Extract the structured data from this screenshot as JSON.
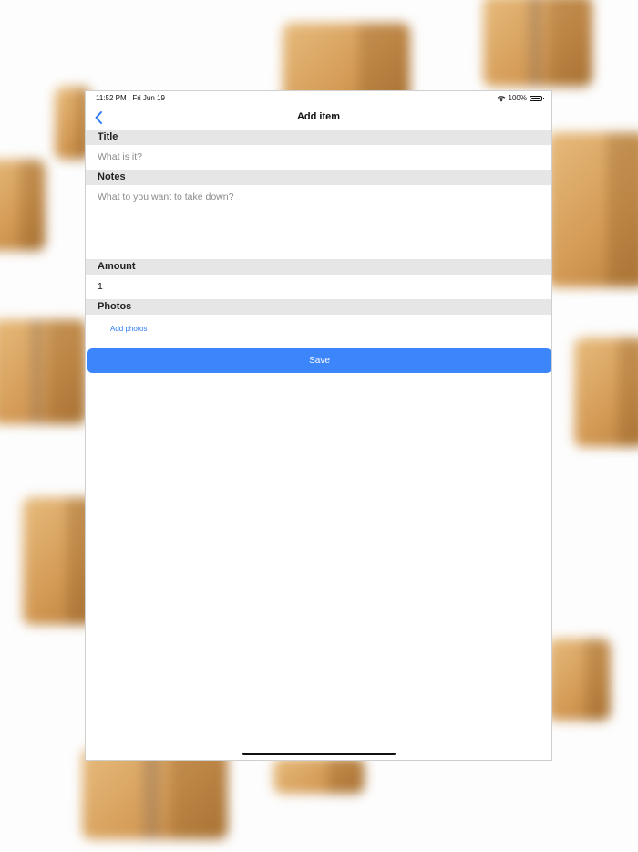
{
  "status_bar": {
    "time": "11:52 PM",
    "date": "Fri Jun 19",
    "battery": "100%",
    "wifi_icon": "wifi-icon",
    "battery_icon": "battery-icon"
  },
  "nav": {
    "title": "Add item",
    "back_icon": "chevron-left-icon"
  },
  "form": {
    "title": {
      "header": "Title",
      "placeholder": "What is it?"
    },
    "notes": {
      "header": "Notes",
      "placeholder": "What to you want to take down?"
    },
    "amount": {
      "header": "Amount",
      "value": "1"
    },
    "photos": {
      "header": "Photos",
      "add_label": "Add photos"
    },
    "save_label": "Save"
  },
  "colors": {
    "accent": "#3d85fb",
    "link": "#2f7bf5",
    "section_header_bg": "#e6e6e6",
    "box_brown": "#d39a55"
  }
}
